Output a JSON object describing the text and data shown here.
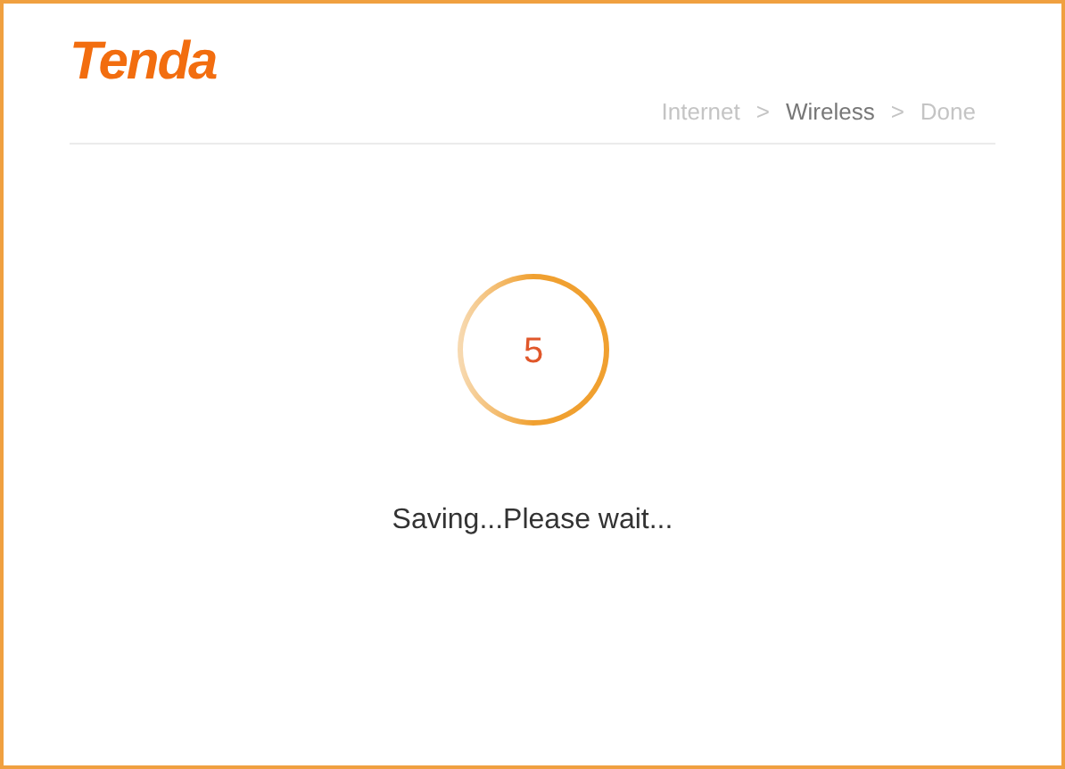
{
  "logo": "Tenda",
  "steps": [
    {
      "kind": "step",
      "label": "Internet",
      "selected": false
    },
    {
      "kind": "separator",
      "label": ">"
    },
    {
      "kind": "step",
      "label": "Wireless",
      "selected": true
    },
    {
      "kind": "separator",
      "label": ">"
    },
    {
      "kind": "step",
      "label": "Done",
      "selected": false
    }
  ],
  "countdown": "5",
  "message": "Saving...Please wait..."
}
